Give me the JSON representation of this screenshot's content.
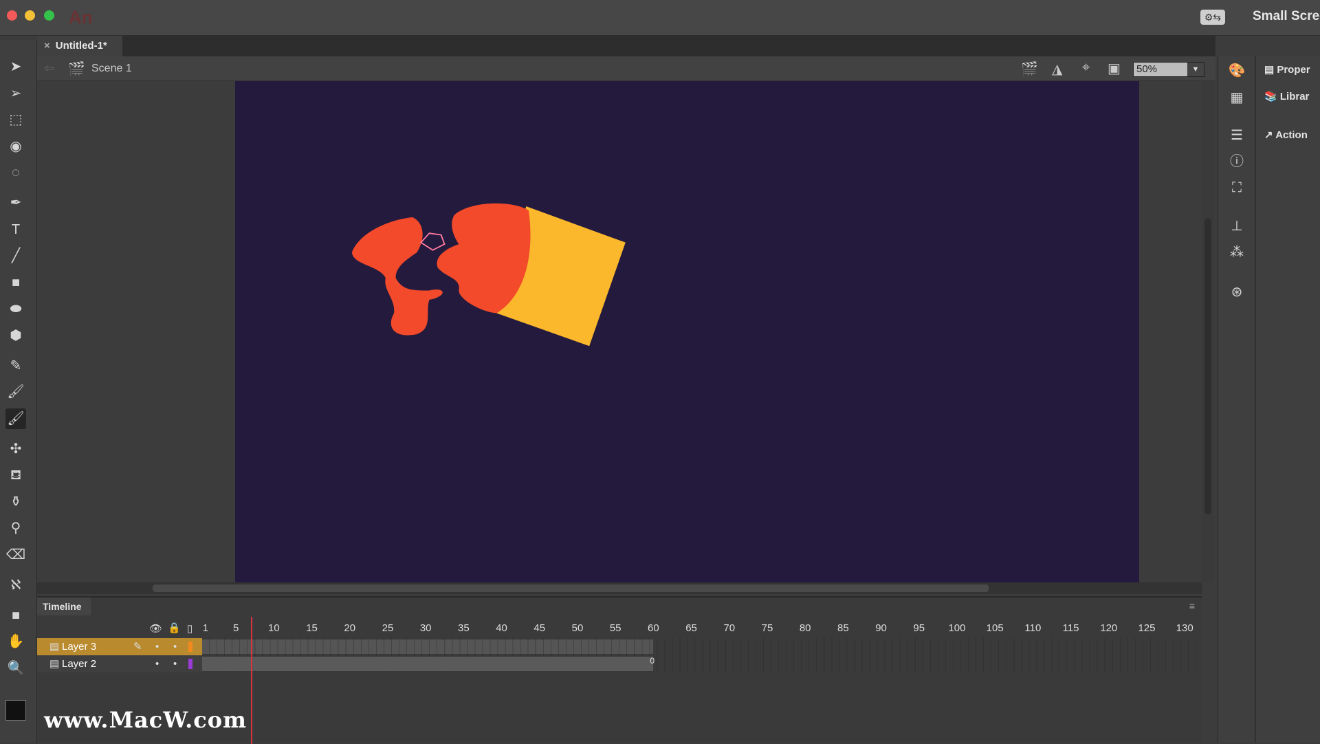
{
  "titlebar": {
    "app_logo": "An",
    "workspace_label": "Small Scree",
    "workspace_icon": "gear-swap-icon"
  },
  "document": {
    "tab_title": "Untitled-1*",
    "close": "×",
    "scene_label": "Scene 1"
  },
  "stage_toolbar": {
    "zoom_value": "50%"
  },
  "stage": {
    "background": "#231a3e",
    "shape_colors": {
      "red": "#f24a2a",
      "yellow": "#fbb82c"
    }
  },
  "tools": [
    "selection",
    "subselection",
    "free-transform",
    "3d-rotation",
    "lasso",
    "pen",
    "text",
    "line",
    "rectangle",
    "oval",
    "polystar",
    "pencil",
    "paint-brush",
    "brush",
    "bone",
    "paint-bucket",
    "ink-bottle",
    "eyedropper",
    "eraser",
    "width",
    "camera",
    "hand",
    "zoom"
  ],
  "active_tool": "brush",
  "right_panels": [
    {
      "label": "Proper",
      "icon": "properties-icon"
    },
    {
      "label": "Librar",
      "icon": "library-icon"
    },
    {
      "label": "Action",
      "icon": "actions-icon"
    }
  ],
  "timeline": {
    "title": "Timeline",
    "frame_numbers": [
      1,
      5,
      10,
      15,
      20,
      25,
      30,
      35,
      40,
      45,
      50,
      55,
      60,
      65,
      70,
      75,
      80,
      85,
      90,
      95,
      100,
      105,
      110,
      115,
      120,
      125,
      130
    ],
    "current_frame": 7,
    "layers": [
      {
        "name": "Layer 3",
        "color": "#f08a1c",
        "selected": true,
        "last_frame": 60
      },
      {
        "name": "Layer 2",
        "color": "#9b3bd6",
        "selected": false,
        "last_frame": 60,
        "end_marker": "0"
      }
    ]
  },
  "watermark": "www.MacW.com"
}
